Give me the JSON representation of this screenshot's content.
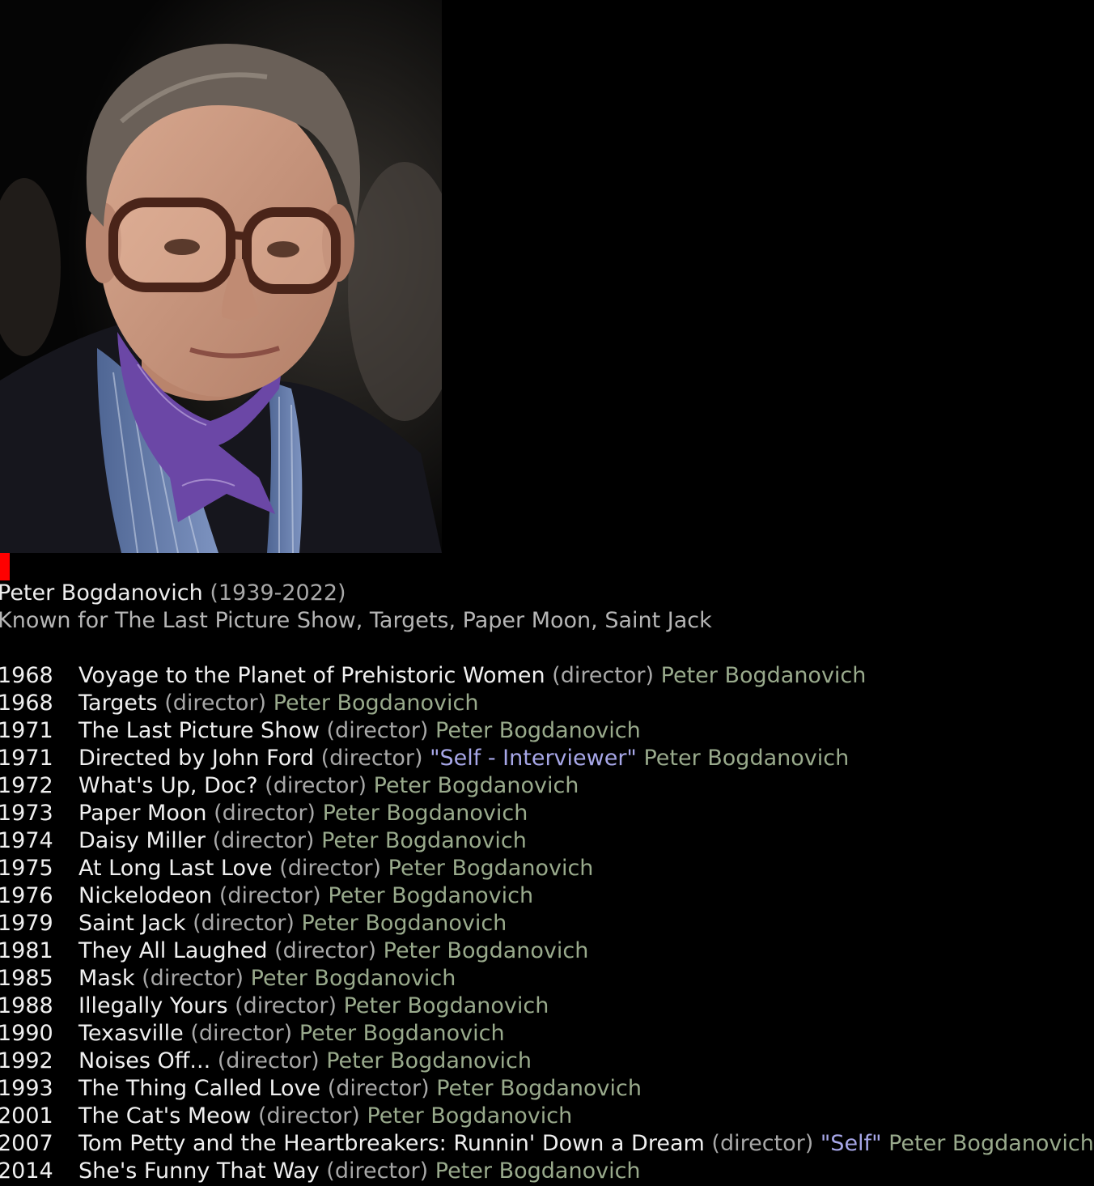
{
  "person": {
    "name": "Peter Bogdanovich",
    "years": "(1939-2022)",
    "known_for": "Known for The Last Picture Show, Targets, Paper Moon, Saint Jack"
  },
  "portrait": {
    "description": "portrait-photo",
    "colors": {
      "background": "#0a0a0a",
      "skin": "#c9977f",
      "hair": "#6a6058",
      "jacket": "#15151c",
      "shirt": "#5f78a8",
      "scarf": "#6b47a6",
      "glasses": "#5a2f22"
    }
  },
  "colors": {
    "background": "#000000",
    "text": "#f0f0f0",
    "muted": "#a8a8a8",
    "character": "#a7a7e8",
    "person_link": "#99aa8c",
    "cursor": "#ff0000"
  },
  "films": [
    {
      "year": "1968",
      "title": "Voyage to the Planet of Prehistoric Women",
      "role": "(director)",
      "character": "",
      "person": "Peter Bogdanovich"
    },
    {
      "year": "1968",
      "title": "Targets",
      "role": "(director)",
      "character": "",
      "person": "Peter Bogdanovich"
    },
    {
      "year": "1971",
      "title": "The Last Picture Show",
      "role": "(director)",
      "character": "",
      "person": "Peter Bogdanovich"
    },
    {
      "year": "1971",
      "title": "Directed by John Ford",
      "role": "(director)",
      "character": "\"Self - Interviewer\"",
      "person": "Peter Bogdanovich"
    },
    {
      "year": "1972",
      "title": "What's Up, Doc?",
      "role": "(director)",
      "character": "",
      "person": "Peter Bogdanovich"
    },
    {
      "year": "1973",
      "title": "Paper Moon",
      "role": "(director)",
      "character": "",
      "person": "Peter Bogdanovich"
    },
    {
      "year": "1974",
      "title": "Daisy Miller",
      "role": "(director)",
      "character": "",
      "person": "Peter Bogdanovich"
    },
    {
      "year": "1975",
      "title": "At Long Last Love",
      "role": "(director)",
      "character": "",
      "person": "Peter Bogdanovich"
    },
    {
      "year": "1976",
      "title": "Nickelodeon",
      "role": "(director)",
      "character": "",
      "person": "Peter Bogdanovich"
    },
    {
      "year": "1979",
      "title": "Saint Jack",
      "role": "(director)",
      "character": "",
      "person": "Peter Bogdanovich"
    },
    {
      "year": "1981",
      "title": "They All Laughed",
      "role": "(director)",
      "character": "",
      "person": "Peter Bogdanovich"
    },
    {
      "year": "1985",
      "title": "Mask",
      "role": "(director)",
      "character": "",
      "person": "Peter Bogdanovich"
    },
    {
      "year": "1988",
      "title": "Illegally Yours",
      "role": "(director)",
      "character": "",
      "person": "Peter Bogdanovich"
    },
    {
      "year": "1990",
      "title": "Texasville",
      "role": "(director)",
      "character": "",
      "person": "Peter Bogdanovich"
    },
    {
      "year": "1992",
      "title": "Noises Off...",
      "role": "(director)",
      "character": "",
      "person": "Peter Bogdanovich"
    },
    {
      "year": "1993",
      "title": "The Thing Called Love",
      "role": "(director)",
      "character": "",
      "person": "Peter Bogdanovich"
    },
    {
      "year": "2001",
      "title": "The Cat's Meow",
      "role": "(director)",
      "character": "",
      "person": "Peter Bogdanovich"
    },
    {
      "year": "2007",
      "title": "Tom Petty and the Heartbreakers: Runnin' Down a Dream",
      "role": "(director)",
      "character": "\"Self\"",
      "person": "Peter Bogdanovich"
    },
    {
      "year": "2014",
      "title": "She's Funny That Way",
      "role": "(director)",
      "character": "",
      "person": "Peter Bogdanovich"
    }
  ]
}
